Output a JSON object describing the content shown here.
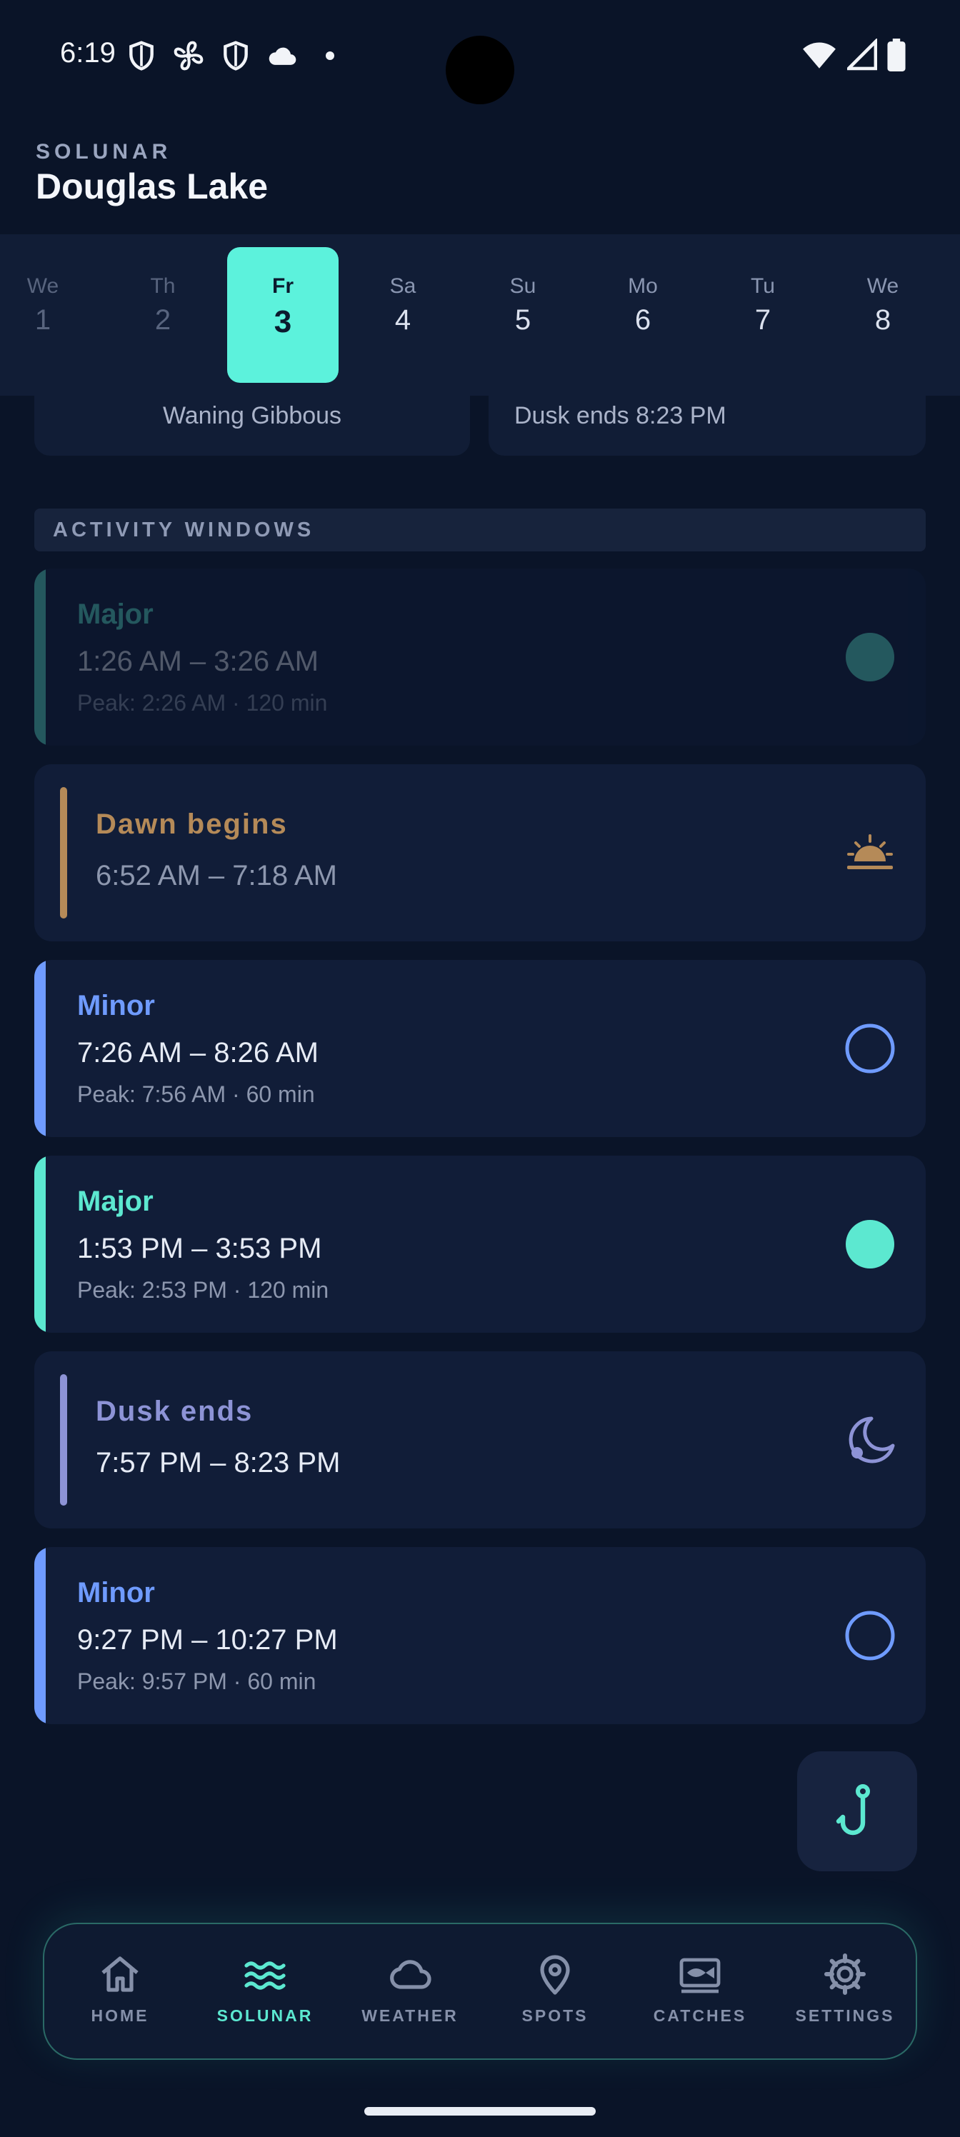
{
  "status_bar": {
    "time": "6:19",
    "left_icons": [
      "shield-icon",
      "fan-icon",
      "shield-icon",
      "cloud-icon"
    ],
    "right_icons": [
      "wifi-icon",
      "signal-icon",
      "battery-icon"
    ]
  },
  "header": {
    "eyebrow": "SOLUNAR",
    "title": "Douglas Lake"
  },
  "days": [
    {
      "name": "We",
      "num": "1"
    },
    {
      "name": "Th",
      "num": "2"
    },
    {
      "name": "Fr",
      "num": "3"
    },
    {
      "name": "Sa",
      "num": "4"
    },
    {
      "name": "Su",
      "num": "5"
    },
    {
      "name": "Mo",
      "num": "6"
    },
    {
      "name": "Tu",
      "num": "7"
    },
    {
      "name": "We",
      "num": "8"
    }
  ],
  "summary": {
    "moon_phase": "Waning Gibbous",
    "dusk": "Dusk ends 8:23 PM"
  },
  "section_title": "ACTIVITY WINDOWS",
  "windows": [
    {
      "title": "Major",
      "time": "1:26 AM – 3:26 AM",
      "peak": "Peak: 2:26 AM · 120 min"
    },
    {
      "title": "Dawn begins",
      "time": "6:52 AM – 7:18 AM"
    },
    {
      "title": "Minor",
      "time": "7:26 AM – 8:26 AM",
      "peak": "Peak: 7:56 AM · 60 min"
    },
    {
      "title": "Major",
      "time": "1:53 PM – 3:53 PM",
      "peak": "Peak: 2:53 PM · 120 min"
    },
    {
      "title": "Dusk ends",
      "time": "7:57 PM – 8:23 PM"
    },
    {
      "title": "Minor",
      "time": "9:27 PM – 10:27 PM",
      "peak": "Peak: 9:57 PM · 60 min"
    }
  ],
  "nav": [
    {
      "label": "HOME",
      "icon": "home-icon"
    },
    {
      "label": "SOLUNAR",
      "icon": "waves-icon"
    },
    {
      "label": "WEATHER",
      "icon": "cloud-icon"
    },
    {
      "label": "SPOTS",
      "icon": "pin-icon"
    },
    {
      "label": "CATCHES",
      "icon": "fish-icon"
    },
    {
      "label": "SETTINGS",
      "icon": "gear-icon"
    }
  ],
  "colors": {
    "background": "#0a1428",
    "card": "#111d38",
    "accent_teal": "#5ce8d0",
    "minor_blue": "#6f9bff",
    "dawn_brown": "#b58a58",
    "dusk_purple": "#8d93d6"
  }
}
